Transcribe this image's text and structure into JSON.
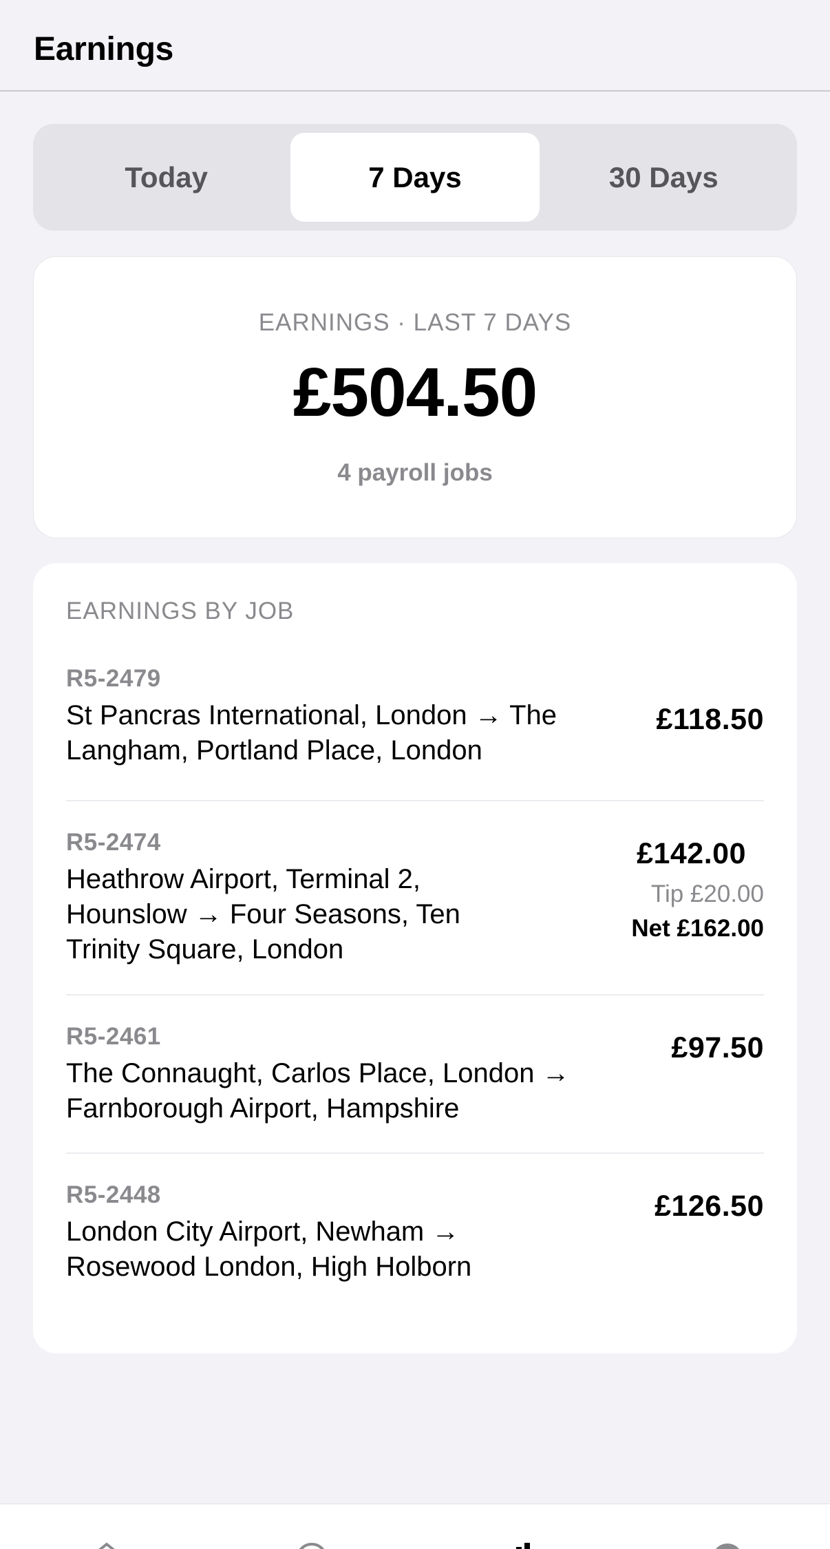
{
  "header": {
    "title": "Earnings"
  },
  "periods": {
    "tabs": [
      {
        "label": "Today"
      },
      {
        "label": "7 Days"
      },
      {
        "label": "30 Days"
      }
    ],
    "selected": "7 Days"
  },
  "summary": {
    "caption": "EARNINGS · LAST 7 DAYS",
    "amount": "£504.50",
    "subtitle": "4 payroll jobs"
  },
  "jobs": {
    "heading": "EARNINGS BY JOB",
    "items": [
      {
        "id": "R5-2479",
        "route": "St Pancras International, London → The Langham, Portland Place, London",
        "amount": "£118.50"
      },
      {
        "id": "R5-2474",
        "route": "Heathrow Airport, Terminal 2, Hounslow → Four Seasons, Ten Trinity Square, London",
        "amount": "£142.00",
        "tip": "Tip £20.00",
        "net": "Net £162.00"
      },
      {
        "id": "R5-2461",
        "route": "The Connaught, Carlos Place, London → Farnborough Airport, Hampshire",
        "amount": "£97.50"
      },
      {
        "id": "R5-2448",
        "route": "London City Airport, Newham → Rosewood London, High Holborn",
        "amount": "£126.50"
      }
    ]
  },
  "tabbar": {
    "icons": [
      "home-icon",
      "clock-icon",
      "chart-icon",
      "profile-icon"
    ]
  }
}
